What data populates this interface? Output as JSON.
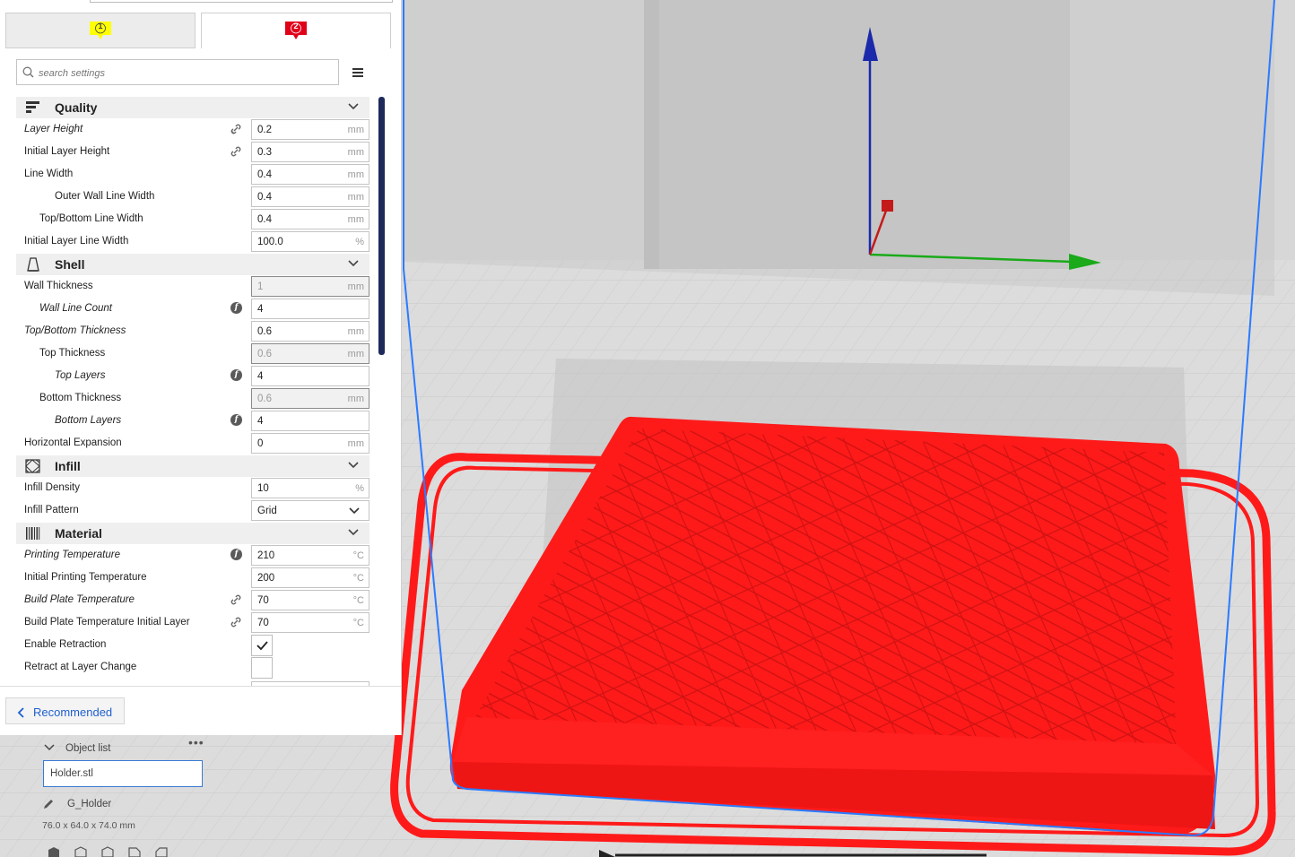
{
  "tabs": [
    {
      "badge": "1",
      "color": "#ffff00"
    },
    {
      "badge": "2",
      "color": "#e0001a"
    }
  ],
  "search": {
    "placeholder": "search settings"
  },
  "categories": {
    "quality": "Quality",
    "shell": "Shell",
    "infill": "Infill",
    "material": "Material"
  },
  "settings": [
    {
      "label": "Layer Height",
      "value": "0.2",
      "unit": "mm"
    },
    {
      "label": "Initial Layer Height",
      "value": "0.3",
      "unit": "mm"
    },
    {
      "label": "Line Width",
      "value": "0.4",
      "unit": "mm"
    },
    {
      "label": "Outer Wall Line Width",
      "value": "0.4",
      "unit": "mm"
    },
    {
      "label": "Top/Bottom Line Width",
      "value": "0.4",
      "unit": "mm"
    },
    {
      "label": "Initial Layer Line Width",
      "value": "100.0",
      "unit": "%"
    },
    {
      "label": "Wall Thickness",
      "value": "1",
      "unit": "mm"
    },
    {
      "label": "Wall Line Count",
      "value": "4",
      "unit": ""
    },
    {
      "label": "Top/Bottom Thickness",
      "value": "0.6",
      "unit": "mm"
    },
    {
      "label": "Top Thickness",
      "value": "0.6",
      "unit": "mm"
    },
    {
      "label": "Top Layers",
      "value": "4",
      "unit": ""
    },
    {
      "label": "Bottom Thickness",
      "value": "0.6",
      "unit": "mm"
    },
    {
      "label": "Bottom Layers",
      "value": "4",
      "unit": ""
    },
    {
      "label": "Horizontal Expansion",
      "value": "0",
      "unit": "mm"
    },
    {
      "label": "Infill Density",
      "value": "10",
      "unit": "%"
    },
    {
      "label": "Infill Pattern",
      "value": "Grid",
      "unit": ""
    },
    {
      "label": "Printing Temperature",
      "value": "210",
      "unit": "°C"
    },
    {
      "label": "Initial Printing Temperature",
      "value": "200",
      "unit": "°C"
    },
    {
      "label": "Build Plate Temperature",
      "value": "70",
      "unit": "°C"
    },
    {
      "label": "Build Plate Temperature Initial Layer",
      "value": "70",
      "unit": "°C"
    },
    {
      "label": "Enable Retraction",
      "checked": true
    },
    {
      "label": "Retract at Layer Change",
      "checked": false
    }
  ],
  "footer": {
    "recommended_label": "Recommended"
  },
  "object_list": {
    "title": "Object list",
    "file": "Holder.stl",
    "object_name": "G_Holder",
    "dimensions": "76.0 x 64.0 x 74.0 mm"
  },
  "colors": {
    "model": "#ff1a1a",
    "build_volume_outline": "#2b7bff",
    "axis_x": "#1aaa1a",
    "axis_y": "#c41a1a",
    "axis_z": "#1a2aaa",
    "accent": "#1f5fcf"
  },
  "icons": [
    "search-icon",
    "menu-icon",
    "quality-icon",
    "shell-icon",
    "infill-icon",
    "material-icon",
    "link-icon",
    "function-icon",
    "chevron-down-icon",
    "check-icon",
    "chevron-left-icon",
    "pencil-icon"
  ]
}
